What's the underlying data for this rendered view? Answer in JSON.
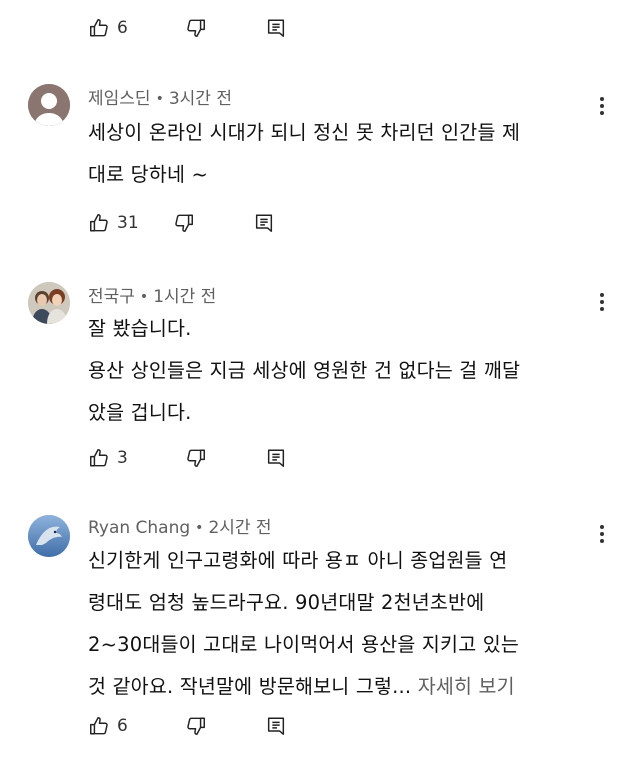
{
  "top_actions": {
    "like_count": "6"
  },
  "comments": [
    {
      "author": "제임스딘",
      "time": "3시간 전",
      "text": "세상이 온라인 시대가 되니 정신 못 차리던 인간들 제\n대로 당하네 ~",
      "like_count": "31",
      "avatar": "avatar-person-icon"
    },
    {
      "author": "전국구",
      "time": "1시간 전",
      "text": "잘 봤습니다.\n용산 상인들은 지금 세상에 영원한 건 없다는 걸 깨달\n았을 겁니다.",
      "like_count": "3",
      "avatar": "avatar-couple-photo"
    },
    {
      "author": "Ryan Chang",
      "time": "2시간 전",
      "text": "신기한게 인구고령화에 따라 용ㅍ 아니 종업원들 연\n령대도 엄청 높드라구요. 90년대말 2천년초반에\n2~30대들이 고대로 나이먹어서 용산을 지키고 있는\n것 같아요. 작년말에 방문해보니 그렇...",
      "more_label": " 자세히 보기",
      "like_count": "6",
      "avatar": "avatar-dolphin-photo"
    }
  ],
  "separator": "•",
  "icons": {
    "like": "thumbs-up-icon",
    "dislike": "thumbs-down-icon",
    "reply": "reply-comment-icon",
    "menu": "more-vert-icon"
  },
  "colors": {
    "text": "#0f0f0f",
    "meta": "#606060",
    "background": "#ffffff"
  }
}
